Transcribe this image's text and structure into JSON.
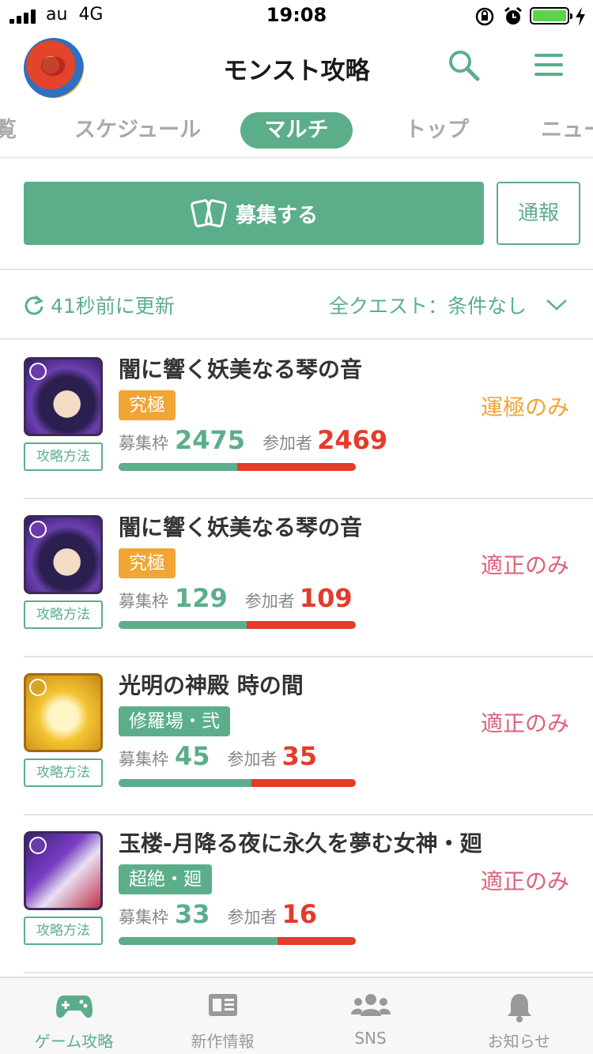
{
  "status_bar": {
    "carrier": "au",
    "network": "4G",
    "time": "19:08"
  },
  "header": {
    "title": "モンスト攻略"
  },
  "tabs": [
    {
      "label": "覧"
    },
    {
      "label": "スケジュール"
    },
    {
      "label": "マルチ",
      "active": true
    },
    {
      "label": "トップ"
    },
    {
      "label": "ニュー"
    }
  ],
  "actions": {
    "recruit_label": "募集する",
    "report_label": "通報"
  },
  "update": {
    "refresh_text": "41秒前に更新",
    "filter_text": "全クエスト：条件なし"
  },
  "labels": {
    "slots": "募集枠",
    "participants": "参加者",
    "guide": "攻略方法"
  },
  "colors": {
    "accent": "#5cae8b",
    "orange": "#f0a535",
    "red": "#e63a2a",
    "pink": "#e0607a"
  },
  "quests": [
    {
      "title": "闇に響く妖美なる琴の音",
      "badge": "究極",
      "badge_color": "#f0a535",
      "condition": "運極のみ",
      "condition_color": "#f0a535",
      "slots": "2475",
      "participants": "2469",
      "icon": "dark-character-icon"
    },
    {
      "title": "闇に響く妖美なる琴の音",
      "badge": "究極",
      "badge_color": "#f0a535",
      "condition": "適正のみ",
      "condition_color": "#e0607a",
      "slots": "129",
      "participants": "109",
      "icon": "dark-character-icon"
    },
    {
      "title": "光明の神殿 時の間",
      "badge": "修羅場・弐",
      "badge_color": "#5cae8b",
      "condition": "適正のみ",
      "condition_color": "#e0607a",
      "slots": "45",
      "participants": "35",
      "icon": "light-character-icon"
    },
    {
      "title": "玉楼-月降る夜に永久を夢む女神・廻",
      "badge": "超絶・廻",
      "badge_color": "#5cae8b",
      "condition": "適正のみ",
      "condition_color": "#e0607a",
      "slots": "33",
      "participants": "16",
      "icon": "dark-character-icon"
    }
  ],
  "bottom_nav": [
    {
      "label": "ゲーム攻略",
      "icon": "gamepad-icon",
      "active": true
    },
    {
      "label": "新作情報",
      "icon": "news-icon"
    },
    {
      "label": "SNS",
      "icon": "people-icon"
    },
    {
      "label": "お知らせ",
      "icon": "bell-icon"
    }
  ]
}
